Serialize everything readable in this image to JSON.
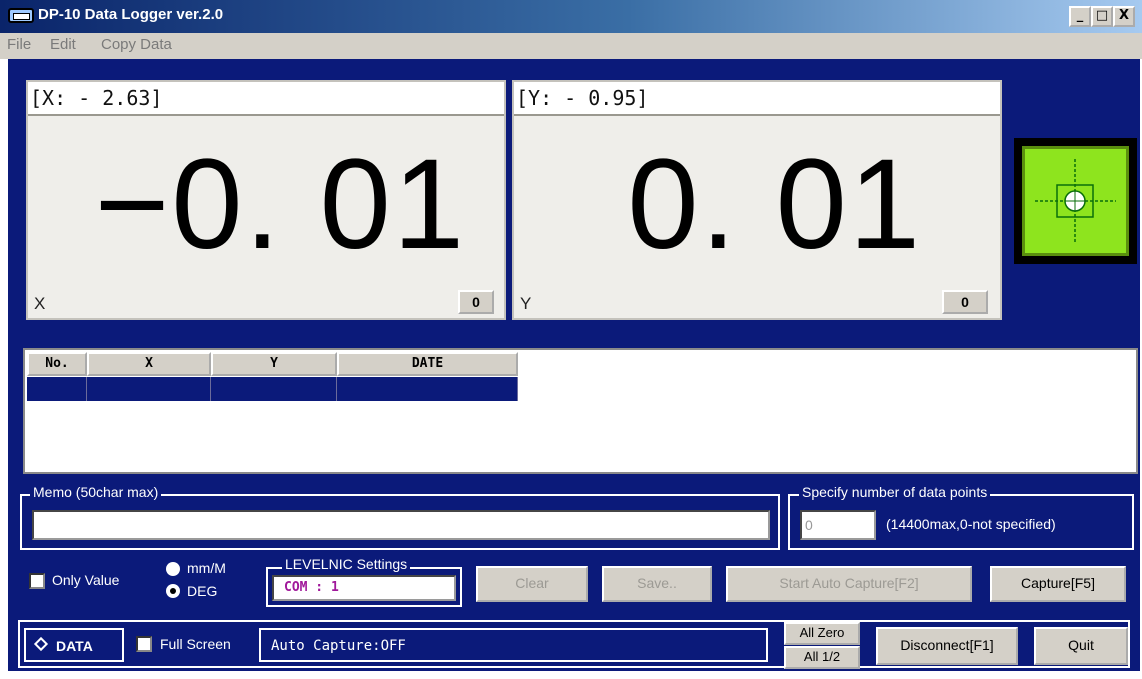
{
  "window": {
    "title": "DP-10 Data Logger ver.2.0",
    "controls": [
      "_",
      "□",
      "X"
    ]
  },
  "menu": [
    "File",
    "Edit",
    "Copy Data"
  ],
  "display": {
    "x": {
      "header": "[X: - 2.63]",
      "value": "−0. 01",
      "axis": "X",
      "zero_label": "0"
    },
    "y": {
      "header": "[Y: - 0.95]",
      "value": "0. 01",
      "axis": "Y",
      "zero_label": "0"
    }
  },
  "level_indicator": {
    "color": "#8ee41e"
  },
  "table": {
    "columns": [
      "No.",
      "X",
      "Y",
      "DATE"
    ],
    "rows": [
      [
        "",
        "",
        "",
        ""
      ]
    ]
  },
  "memo": {
    "legend": "Memo (50char max)",
    "value": ""
  },
  "data_points": {
    "legend": "Specify number of data points",
    "value": "0",
    "note": "(14400max,0-not specified)"
  },
  "options": {
    "only_value": "Only Value",
    "unit_mm": "mm/M",
    "unit_deg": "DEG",
    "selected_unit": "DEG"
  },
  "levelnic": {
    "legend": "LEVELNIC Settings",
    "com": "COM : 1"
  },
  "buttons": {
    "clear": "Clear",
    "save": "Save..",
    "start_auto": "Start Auto Capture[F2]",
    "capture": "Capture[F5]",
    "all_zero": "All Zero",
    "all_half": "All 1/2",
    "disconnect": "Disconnect[F1]",
    "quit": "Quit"
  },
  "status": {
    "data_indicator": "DATA",
    "full_screen": "Full Screen",
    "auto_capture": "Auto Capture:OFF"
  },
  "colors": {
    "panel": "#0b1a7a",
    "title_start": "#0a246a",
    "title_end": "#a6caf0"
  }
}
